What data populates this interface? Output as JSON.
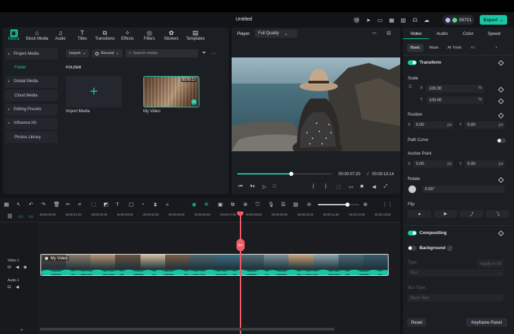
{
  "app": {
    "doc_title": "Untitled",
    "credits": "55721",
    "export_label": "Export",
    "top_icons": [
      "gift-icon",
      "send-icon",
      "save-icon",
      "layout-icon",
      "grid-icon",
      "headset-icon",
      "cloud-icon"
    ]
  },
  "media": {
    "tabs": [
      {
        "label": "Media",
        "icon": "media-icon",
        "glyph": "▣"
      },
      {
        "label": "Stock Media",
        "icon": "stock-media-icon",
        "glyph": "⌂"
      },
      {
        "label": "Audio",
        "icon": "audio-icon",
        "glyph": "♫"
      },
      {
        "label": "Titles",
        "icon": "titles-icon",
        "glyph": "T"
      },
      {
        "label": "Transitions",
        "icon": "transitions-icon",
        "glyph": "⧉"
      },
      {
        "label": "Effects",
        "icon": "effects-icon",
        "glyph": "✧"
      },
      {
        "label": "Filters",
        "icon": "filters-icon",
        "glyph": "◎"
      },
      {
        "label": "Stickers",
        "icon": "stickers-icon",
        "glyph": "✿"
      },
      {
        "label": "Templates",
        "icon": "templates-icon",
        "glyph": "▤"
      }
    ],
    "sidebar": [
      {
        "label": "Project Media",
        "type": "group"
      },
      {
        "label": "Folder",
        "type": "sub"
      },
      {
        "label": "Global Media",
        "type": "group"
      },
      {
        "label": "Cloud Media",
        "type": "plain"
      },
      {
        "label": "Editing Presets",
        "type": "group"
      },
      {
        "label": "Influence Kit",
        "type": "group"
      },
      {
        "label": "Photos Library",
        "type": "plain"
      }
    ],
    "import_label": "Import",
    "record_label": "Record",
    "search_placeholder": "Search media",
    "folder_label": "FOLDER",
    "import_media_label": "Import Media",
    "my_video_label": "My Video",
    "my_video_duration": "00:00:13"
  },
  "player": {
    "label": "Player",
    "quality": "Full Quality",
    "progress": 0.57,
    "current_time": "00:00:07:20",
    "separator": "/",
    "total_time": "00:00:13:14"
  },
  "props": {
    "tabs": [
      "Video",
      "Audio",
      "Color",
      "Speed"
    ],
    "subtabs": [
      "Basic",
      "Mask",
      "AI Tools",
      "Ad"
    ],
    "transform": "Transform",
    "scale": "Scale",
    "scale_x": "100.00",
    "scale_y": "100.00",
    "percent": "%",
    "position": "Position",
    "pos_x": "0.00",
    "pos_y": "0.00",
    "px": "px",
    "path_curve": "Path Curve",
    "anchor_point": "Anchor Point",
    "anchor_x": "0.00",
    "anchor_y": "0.00",
    "rotate": "Rotate",
    "rotate_val": "0.00°",
    "flip": "Flip",
    "compositing": "Compositing",
    "background": "Background",
    "type": "Type",
    "apply_to_all": "Apply to All",
    "type_value": "Blur",
    "blur_style": "Blur Style",
    "blur_style_value": "Basic Blur",
    "reset": "Reset",
    "keyframe_panel": "Keyframe Panel",
    "x_label": "X",
    "y_label": "Y"
  },
  "timeline": {
    "ticks": [
      "00:00:00:00",
      "00:00:01:00",
      "00:00:02:00",
      "00:00:03:00",
      "00:00:04:00",
      "00:00:05:00",
      "00:00:06:00",
      "00:00:07:00",
      "00:00:08:00",
      "00:00:09:00",
      "00:00:10:00",
      "00:00:11:00",
      "00:00:12:00",
      "00:00:13:00"
    ],
    "video_track": "Video 1",
    "audio_track": "Audio 1",
    "clip_title": "My Video",
    "colors": {
      "accent": "#19c6a4",
      "playhead": "#f25c68"
    }
  }
}
